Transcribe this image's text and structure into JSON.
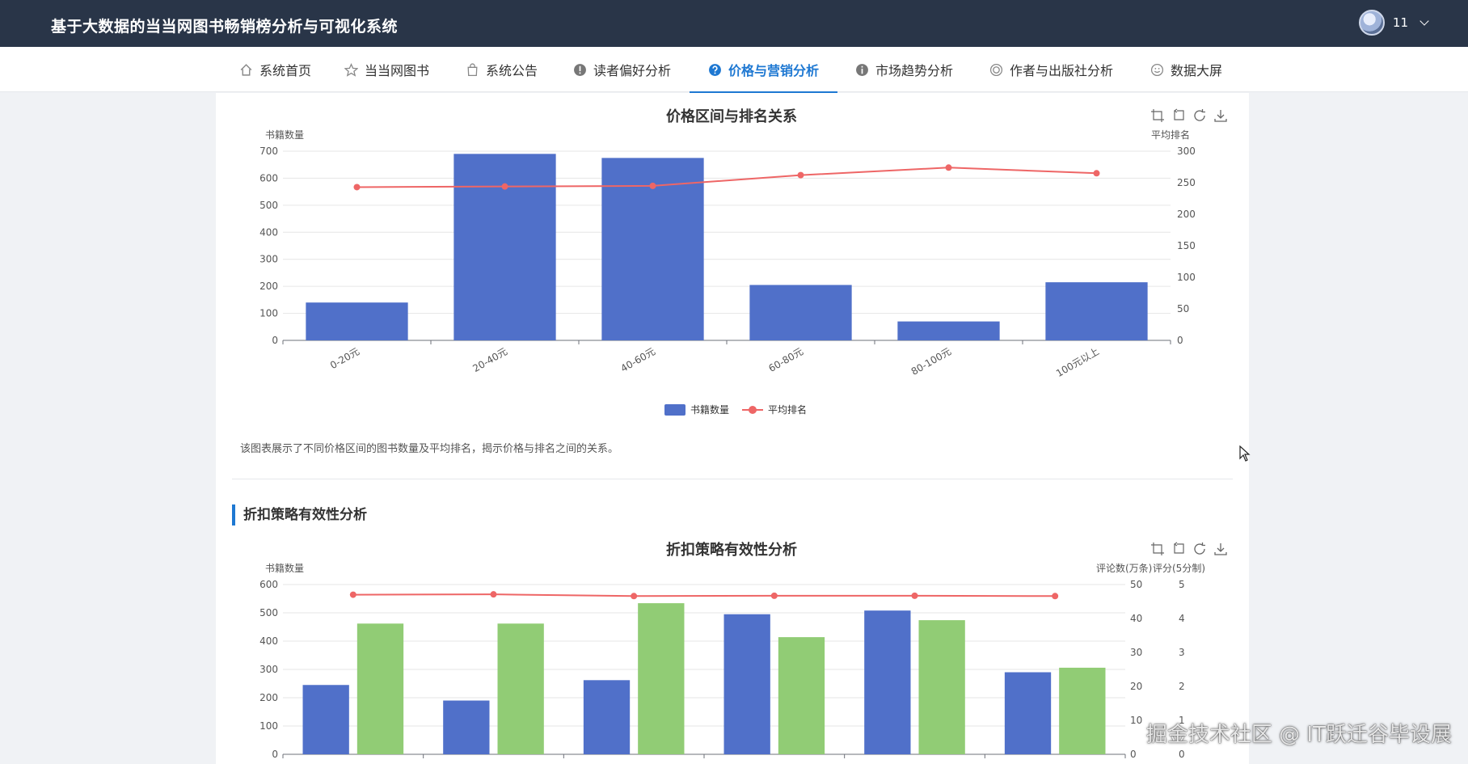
{
  "header": {
    "title": "基于大数据的当当网图书畅销榜分析与可视化系统",
    "user_name": "11"
  },
  "nav": [
    {
      "label": "系统首页",
      "icon": "home-icon"
    },
    {
      "label": "当当网图书",
      "icon": "star-icon"
    },
    {
      "label": "系统公告",
      "icon": "bag-icon"
    },
    {
      "label": "读者偏好分析",
      "icon": "alert-circle-icon"
    },
    {
      "label": "价格与营销分析",
      "icon": "question-circle-icon",
      "active": true
    },
    {
      "label": "市场趋势分析",
      "icon": "info-circle-icon"
    },
    {
      "label": "作者与出版社分析",
      "icon": "badge-icon"
    },
    {
      "label": "数据大屏",
      "icon": "smile-icon"
    }
  ],
  "toolbox_icons": [
    "zoom-icon",
    "zoom-reset-icon",
    "restore-icon",
    "download-icon"
  ],
  "chart1": {
    "description": "该图表展示了不同价格区间的图书数量及平均排名，揭示价格与排名之间的关系。"
  },
  "section2": {
    "title": "折扣策略有效性分析"
  },
  "watermark": "掘金技术社区 @ IT跃迁谷毕设展",
  "chart_data": [
    {
      "type": "bar",
      "title": "价格区间与排名关系",
      "categories": [
        "0-20元",
        "20-40元",
        "40-60元",
        "60-80元",
        "80-100元",
        "100元以上"
      ],
      "series": [
        {
          "name": "书籍数量",
          "type": "bar",
          "axis": "left",
          "color": "#5070c9",
          "values": [
            140,
            690,
            675,
            205,
            70,
            215
          ]
        },
        {
          "name": "平均排名",
          "type": "line",
          "axis": "right",
          "color": "#ee6666",
          "values": [
            243,
            244,
            245,
            262,
            274,
            265
          ]
        }
      ],
      "ylabel_left": "书籍数量",
      "ylabel_right": "平均排名",
      "ylim_left": [
        0,
        700
      ],
      "yticks_left": [
        0,
        100,
        200,
        300,
        400,
        500,
        600,
        700
      ],
      "ylim_right": [
        0,
        300
      ],
      "yticks_right": [
        0,
        50,
        100,
        150,
        200,
        250,
        300
      ],
      "legend": "bottom",
      "grid": true
    },
    {
      "type": "bar",
      "title": "折扣策略有效性分析",
      "series": [
        {
          "axis": "left",
          "color": "#5070c9",
          "values": [
            245,
            190,
            262,
            495,
            508,
            290
          ]
        },
        {
          "axis": "right1",
          "color": "#91cc75",
          "values": [
            38.5,
            38.5,
            44.5,
            34.5,
            39.5,
            25.5
          ]
        },
        {
          "axis": "right2",
          "type": "line",
          "color": "#ee6666",
          "values": [
            4.7,
            4.71,
            4.66,
            4.67,
            4.67,
            4.66
          ]
        }
      ],
      "ylabel_left": "书籍数量",
      "ylabel_right": "评论数(万条)",
      "ylabel_right2": "评分(5分制)",
      "ylim_left": [
        0,
        600
      ],
      "yticks_left": [
        0,
        100,
        200,
        300,
        400,
        500,
        600
      ],
      "ylim_right1": [
        0,
        50
      ],
      "yticks_right1": [
        0,
        10,
        20,
        30,
        40,
        50
      ],
      "ylim_right2": [
        0,
        5
      ],
      "yticks_right2": [
        0,
        1,
        2,
        3,
        4,
        5
      ],
      "grid": true
    }
  ]
}
